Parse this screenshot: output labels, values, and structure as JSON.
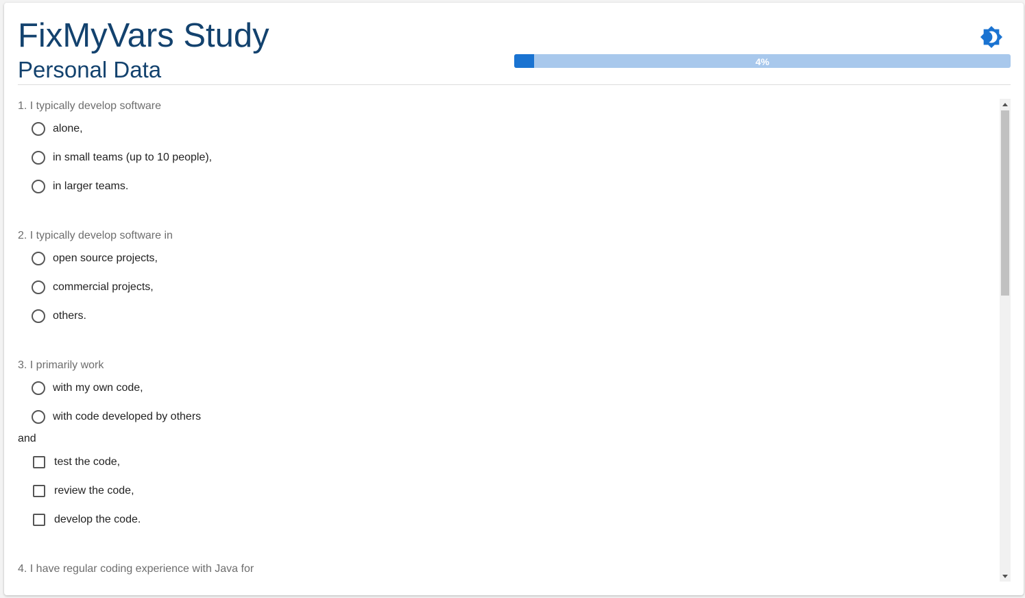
{
  "header": {
    "title": "FixMyVars Study",
    "subtitle": "Personal Data",
    "theme_icon": "brightness-icon",
    "progress": {
      "value_percent": 4,
      "label": "4%"
    }
  },
  "questions": [
    {
      "label": "1. I typically develop software",
      "options": [
        "alone,",
        "in small teams (up to 10 people),",
        "in larger teams."
      ]
    },
    {
      "label": "2. I typically develop software in",
      "options": [
        "open source projects,",
        "commercial projects,",
        "others."
      ]
    },
    {
      "label": "3. I primarily work",
      "options": [
        "with my own code,",
        "with code developed by others"
      ],
      "connector": "and",
      "checkboxes": [
        "test the code,",
        "review the code,",
        "develop the code."
      ]
    },
    {
      "label": "4. I have regular coding experience with Java for"
    }
  ],
  "colors": {
    "title": "#13426e",
    "accent": "#1a73d1",
    "progress_track": "#a8c8ec"
  }
}
